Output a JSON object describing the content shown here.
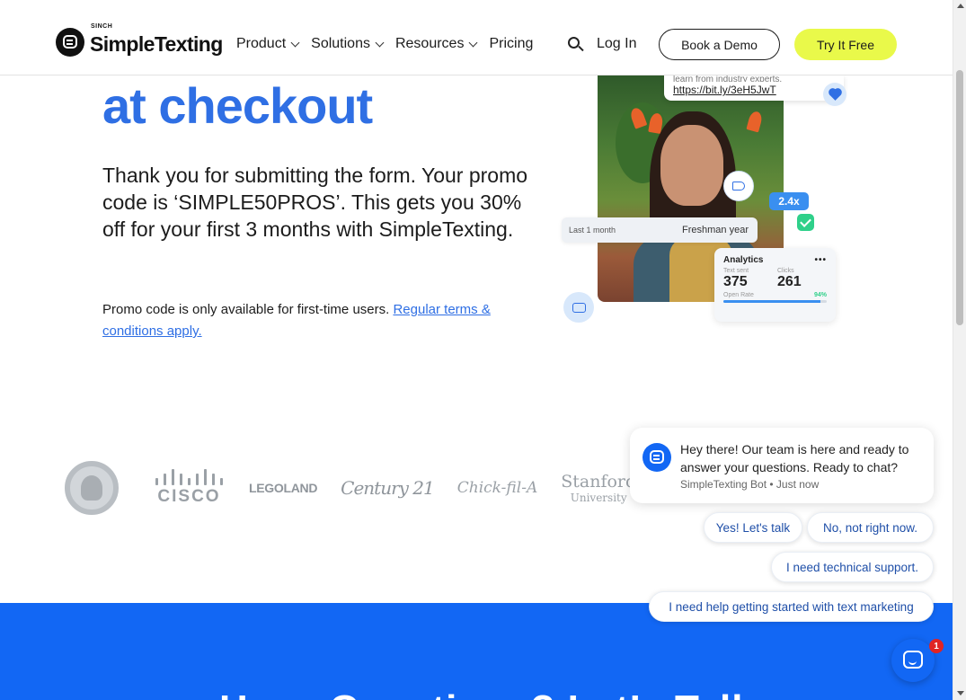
{
  "header": {
    "brand_small": "SINCH",
    "brand_name": "SimpleTexting",
    "nav": [
      "Product",
      "Solutions",
      "Resources",
      "Pricing"
    ],
    "login_label": "Log In",
    "demo_label": "Book a Demo",
    "try_label": "Try It Free",
    "accent_color": "#e9f94a"
  },
  "hero": {
    "title": "at checkout",
    "body": "Thank you for submitting the form. Your promo code is ‘SIMPLE50PROS’. This gets you 30% off for your first 3 months with SimpleTexting.",
    "note": "Promo code is only available for first-time users.",
    "terms_link": "Regular terms & conditions apply.",
    "title_color": "#2f6fe4"
  },
  "collage": {
    "faded_text": "learn from industry experts.",
    "short_link": "https://bit.ly/3eH5JwT",
    "multiplier": "2.4x",
    "period_left": "Last 1 month",
    "period_right": "Freshman year",
    "analytics": {
      "title": "Analytics",
      "menu": "•••",
      "sent_label": "Text sent",
      "sent_value": "375",
      "clicks_label": "Clicks",
      "clicks_value": "261",
      "rate_label": "Open Rate",
      "rate_value": "94%",
      "rate_fraction": 0.94
    }
  },
  "logos": {
    "cisco": "CISCO",
    "legoland": "LEGOLAND",
    "century": "Century 21",
    "chickfila": "Chick-fil-A",
    "stanford_top": "Stanford",
    "stanford_bottom": "University"
  },
  "band": {
    "heading": "Have Questions? Let’s Talk",
    "color": "#1267f4"
  },
  "chat": {
    "message": "Hey there! Our team is here and ready to answer your questions. Ready to chat?",
    "meta": "SimpleTexting Bot • Just now",
    "replies": [
      "Yes! Let's talk",
      "No, not right now.",
      "I need technical support.",
      "I need help getting started with text marketing"
    ],
    "badge_count": "1"
  }
}
